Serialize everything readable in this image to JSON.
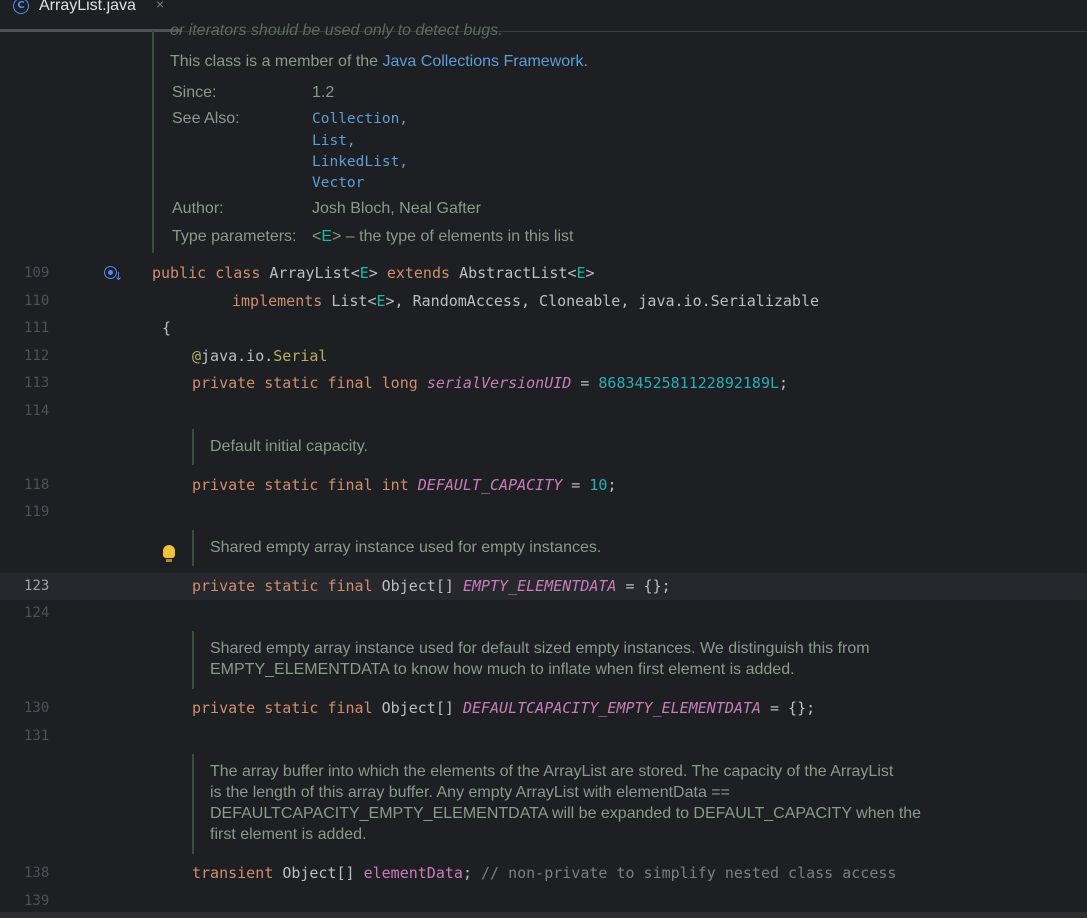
{
  "tab": {
    "label": "ArrayList.java",
    "icon": "class-icon",
    "close": "×"
  },
  "doc_top": {
    "cut_text": "or iterators should be used only to detect bugs.",
    "member_prefix": "This class is a member of the ",
    "member_link": "Java Collections Framework",
    "member_suffix": ".",
    "since_label": "Since:",
    "since_value": "1.2",
    "see_also_label": "See Also:",
    "see_also": [
      "Collection,",
      "List,",
      "LinkedList,",
      "Vector"
    ],
    "author_label": "Author:",
    "author_value": "Josh Bloch, Neal Gafter",
    "type_params_label": "Type parameters:",
    "type_params_value_pre": "<",
    "type_params_E": "E",
    "type_params_value_post": "> – the type of elements in this list"
  },
  "lines": {
    "l109": "109",
    "l110": "110",
    "l111": "111",
    "l112": "112",
    "l113": "113",
    "l114": "114",
    "l118": "118",
    "l119": "119",
    "l123": "123",
    "l124": "124",
    "l130": "130",
    "l131": "131",
    "l138": "138",
    "l139": "139"
  },
  "code": {
    "c109_public": "public",
    "c109_class": "class",
    "c109_name": "ArrayList",
    "c109_lt": "<",
    "c109_E": "E",
    "c109_gt": ">",
    "c109_extends": "extends",
    "c109_super": "AbstractList",
    "c109_lt2": "<",
    "c109_E2": "E",
    "c109_gt2": ">",
    "c110_implements": "implements",
    "c110_list": "List",
    "c110_lt": "<",
    "c110_E": "E",
    "c110_rest": ">, RandomAccess, Cloneable, java.io.Serializable",
    "c111": "{",
    "c112_at": "@",
    "c112_pkg": "java.io.",
    "c112_ann": "Serial",
    "c113_mods": "private static final long",
    "c113_field": "serialVersionUID",
    "c113_eq": " = ",
    "c113_num": "8683452581122892189L",
    "c113_semi": ";",
    "c118_mods": "private static final int",
    "c118_field": "DEFAULT_CAPACITY",
    "c118_eq": " = ",
    "c118_num": "10",
    "c118_semi": ";",
    "c123_mods": "private static final",
    "c123_type": "Object[]",
    "c123_field": "EMPTY_ELEMENTDATA",
    "c123_rest": " = {};",
    "c130_mods": "private static final",
    "c130_type": "Object[]",
    "c130_field": "DEFAULTCAPACITY_EMPTY_ELEMENTDATA",
    "c130_rest": " = {};",
    "c138_mod": "transient",
    "c138_type": "Object[]",
    "c138_field": "elementData",
    "c138_semi": ";",
    "c138_comment": "// non-private to simplify nested class access"
  },
  "docs": {
    "d_capacity": "Default initial capacity.",
    "d_empty": "Shared empty array instance used for empty instances.",
    "d_default_1": "Shared empty array instance used for default sized empty instances. We distinguish this from",
    "d_default_2": "EMPTY_ELEMENTDATA to know how much to inflate when first element is added.",
    "d_buffer_1": "The array buffer into which the elements of the ArrayList are stored. The capacity of the ArrayList",
    "d_buffer_2": "is the length of this array buffer. Any empty ArrayList with elementData ==",
    "d_buffer_3": "DEFAULTCAPACITY_EMPTY_ELEMENTDATA will be expanded to DEFAULT_CAPACITY when the",
    "d_buffer_4": "first element is added."
  }
}
